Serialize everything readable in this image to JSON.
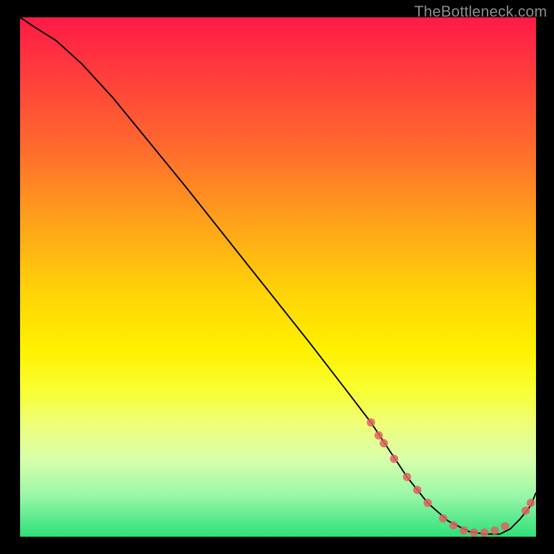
{
  "watermark": "TheBottleneck.com",
  "colors": {
    "background": "#000000",
    "line": "#000000",
    "marker": "#e06262",
    "gradient_top": "#ff1a47",
    "gradient_bottom": "#2de07a"
  },
  "chart_data": {
    "type": "line",
    "title": "",
    "xlabel": "",
    "ylabel": "",
    "xlim": [
      0,
      100
    ],
    "ylim": [
      0,
      100
    ],
    "x": [
      0,
      3,
      7,
      12,
      18,
      25,
      32,
      40,
      48,
      56,
      63,
      68,
      72,
      75,
      79,
      83,
      87,
      90,
      93,
      95,
      97,
      99,
      100
    ],
    "y": [
      100,
      98,
      95.5,
      91,
      84.5,
      76,
      67.5,
      57.5,
      47.5,
      37.5,
      28.5,
      22,
      16,
      11.5,
      6.5,
      3,
      1,
      0.5,
      0.5,
      1.5,
      3.5,
      6,
      8.5
    ],
    "markers": [
      {
        "x": 68,
        "y": 22
      },
      {
        "x": 69.5,
        "y": 19.5
      },
      {
        "x": 70.5,
        "y": 18
      },
      {
        "x": 72.5,
        "y": 15
      },
      {
        "x": 75,
        "y": 11.5
      },
      {
        "x": 77,
        "y": 9
      },
      {
        "x": 79,
        "y": 6.5
      },
      {
        "x": 82,
        "y": 3.5
      },
      {
        "x": 84,
        "y": 2.2
      },
      {
        "x": 86,
        "y": 1.2
      },
      {
        "x": 88,
        "y": 0.8
      },
      {
        "x": 90,
        "y": 0.8
      },
      {
        "x": 92,
        "y": 1.2
      },
      {
        "x": 94,
        "y": 2
      },
      {
        "x": 98,
        "y": 5
      },
      {
        "x": 99,
        "y": 6.5
      }
    ]
  }
}
